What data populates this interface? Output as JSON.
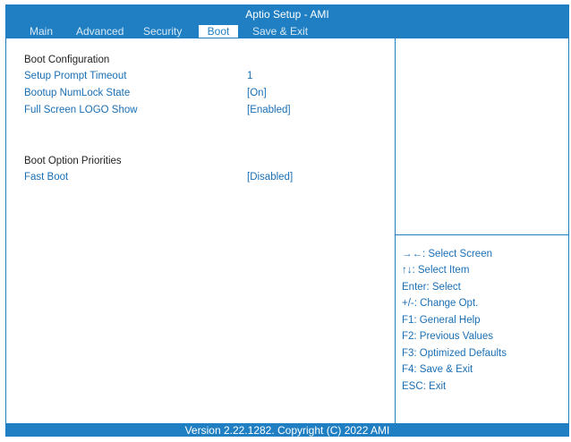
{
  "header": {
    "title": "Aptio Setup - AMI"
  },
  "tabs": [
    {
      "label": "Main"
    },
    {
      "label": "Advanced"
    },
    {
      "label": "Security"
    },
    {
      "label": "Boot"
    },
    {
      "label": "Save & Exit"
    }
  ],
  "active_tab": "Boot",
  "main": {
    "section1_heading": "Boot Configuration",
    "items": [
      {
        "label": "Setup Prompt Timeout",
        "value": "1"
      },
      {
        "label": "Bootup NumLock State",
        "value": "[On]"
      },
      {
        "label": "Full Screen LOGO Show",
        "value": "[Enabled]"
      }
    ],
    "section2_heading": "Boot Option Priorities",
    "items2": [
      {
        "label": "Fast Boot",
        "value": "[Disabled]"
      }
    ]
  },
  "help": [
    "→←: Select Screen",
    "↑↓: Select Item",
    "Enter: Select",
    "+/-: Change Opt.",
    "F1: General Help",
    "F2: Previous Values",
    "F3: Optimized Defaults",
    "F4: Save & Exit",
    "ESC: Exit"
  ],
  "footer": {
    "text": "Version 2.22.1282. Copyright (C) 2022 AMI"
  },
  "colors": {
    "accent": "#1f7fc2",
    "text_blue": "#1a6fb5",
    "heading": "#222222"
  }
}
